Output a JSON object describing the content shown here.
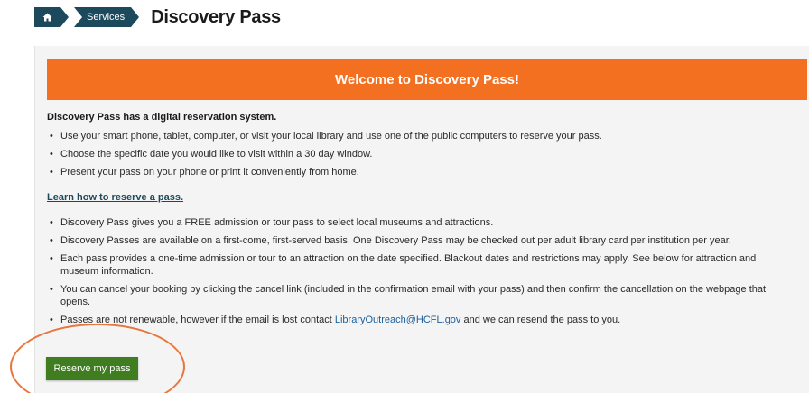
{
  "breadcrumb": {
    "home_icon": "home-icon",
    "services_label": "Services"
  },
  "page_title": "Discovery Pass",
  "banner": {
    "title": "Welcome to Discovery Pass!"
  },
  "intro": "Discovery Pass has a digital reservation system.",
  "steps": [
    "Use your smart phone, tablet, computer, or visit your local library and use one of the public computers to reserve your pass.",
    "Choose the specific date you would like to visit within a 30 day window.",
    "Present your pass on your phone or print it conveniently from home."
  ],
  "learn_link": "Learn how to reserve a pass.",
  "details": [
    "Discovery Pass gives you a FREE admission or tour pass to select local museums and attractions.",
    "Discovery Passes are available on a first-come, first-served basis. One Discovery Pass may be checked out per adult library card per institution per year.",
    "Each pass provides a one-time admission or tour to an attraction on the date specified. Blackout dates and restrictions may apply. See below for attraction and museum information.",
    "You can cancel your booking by clicking the cancel link (included in the confirmation email with your pass) and then confirm the cancellation on the webpage that opens."
  ],
  "last_detail": {
    "before": "Passes are not renewable, however if the email is lost contact ",
    "email": "LibraryOutreach@HCFL.gov",
    "after": " and we can resend the pass to you."
  },
  "reserve_button": "Reserve my pass",
  "colors": {
    "breadcrumb": "#1c4a5c",
    "banner": "#f37021",
    "button": "#3f7d20",
    "highlight_ring": "#e9773d"
  }
}
